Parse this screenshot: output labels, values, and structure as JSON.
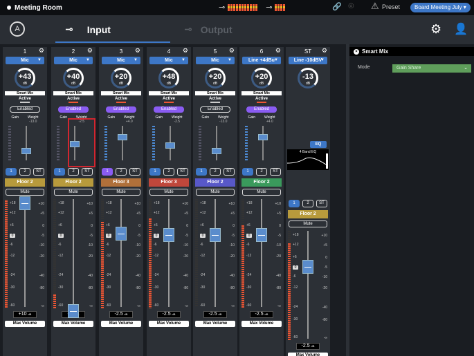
{
  "titlebar": {
    "title": "Meeting Room",
    "preset_label": "Preset",
    "preset_value": "Board Meeting July ▾"
  },
  "nav": {
    "input_label": "Input",
    "output_label": "Output"
  },
  "channels": [
    {
      "num": "1",
      "source": "Mic",
      "gain": "+43",
      "smart_mix": "Smart Mix",
      "active": "Active",
      "enabled": "Enabled",
      "enabled_on": false,
      "gain_lbl": "Gain",
      "weight_lbl": "Weight",
      "weight": "-13.0",
      "routing_sel": "1",
      "zone": "Floor 2",
      "zone_color": "#b79a3c",
      "mute": "Mute",
      "level": "+10",
      "max": "Max Volume"
    },
    {
      "num": "2",
      "source": "Mic",
      "gain": "+40",
      "smart_mix": "Smart Mix",
      "active": "Active",
      "enabled": "Enabled",
      "enabled_on": true,
      "gain_lbl": "Gain",
      "weight_lbl": "Weight",
      "weight": "-2.5",
      "routing_sel": "1",
      "zone": "Floor 2",
      "zone_color": "#b79a3c",
      "mute": "Mute",
      "level": "-Inf",
      "max": "Max Volume"
    },
    {
      "num": "3",
      "source": "Mic",
      "gain": "+20",
      "smart_mix": "Smart Mix",
      "active": "Active",
      "enabled": "Enabled",
      "enabled_on": true,
      "gain_lbl": "Gain",
      "weight_lbl": "Weight",
      "weight": "+4.0",
      "routing_sel": "1",
      "zone": "Floor 3",
      "zone_color": "#b0703a",
      "mute": "Mute",
      "level": "-2.5",
      "max": "Max Volume"
    },
    {
      "num": "4",
      "source": "Mic",
      "gain": "+48",
      "smart_mix": "Smart Mix",
      "active": "Active",
      "enabled": "Enabled",
      "enabled_on": true,
      "gain_lbl": "Gain",
      "weight_lbl": "Weight",
      "weight": "-2.5",
      "routing_sel": "1",
      "zone": "Floor 3",
      "zone_color": "#c0473b",
      "mute": "Mute",
      "level": "-2.5",
      "max": "Max Volume"
    },
    {
      "num": "5",
      "source": "Mic",
      "gain": "+20",
      "smart_mix": "Smart Mix",
      "active": "Active",
      "enabled": "Enabled",
      "enabled_on": false,
      "gain_lbl": "Gain",
      "weight_lbl": "Weight",
      "weight": "-13.0",
      "routing_sel": "1",
      "zone": "Floor 2",
      "zone_color": "#5858c8",
      "mute": "Mute",
      "level": "-2.5",
      "max": "Max Volume"
    },
    {
      "num": "6",
      "source": "Line +4dBu",
      "gain": "+20",
      "smart_mix": "Smart Mix",
      "active": "Active",
      "enabled": "Enabled",
      "enabled_on": true,
      "gain_lbl": "Gain",
      "weight_lbl": "Weight",
      "weight": "+4.0",
      "routing_sel": "1",
      "zone": "Floor 2",
      "zone_color": "#3a9a5c",
      "mute": "Mute",
      "level": "-2.5",
      "max": "Max Volume"
    },
    {
      "num": "ST",
      "source": "Line -10dBV",
      "gain": "-13",
      "eq": "EQ",
      "eq_title": "4 Band EQ",
      "routing_sel": "1",
      "zone": "Floor 2",
      "zone_color": "#b79a3c",
      "mute": "Mute",
      "level": "-2.5",
      "max": "Max Volume"
    }
  ],
  "routing": [
    "1",
    "2",
    "ST"
  ],
  "scale_left": [
    "+18",
    "+12",
    "+6",
    "0",
    "-6",
    "-12",
    "-24",
    "-30",
    "-60"
  ],
  "scale_right": [
    "+10",
    "+5",
    "0",
    "-5",
    "-10",
    "-20",
    "-40",
    "-80",
    "-∞"
  ],
  "db_unit": "dB",
  "smart_mix_panel": {
    "title": "Smart Mix",
    "mode_label": "Mode",
    "mode_value": "Gain Share"
  }
}
